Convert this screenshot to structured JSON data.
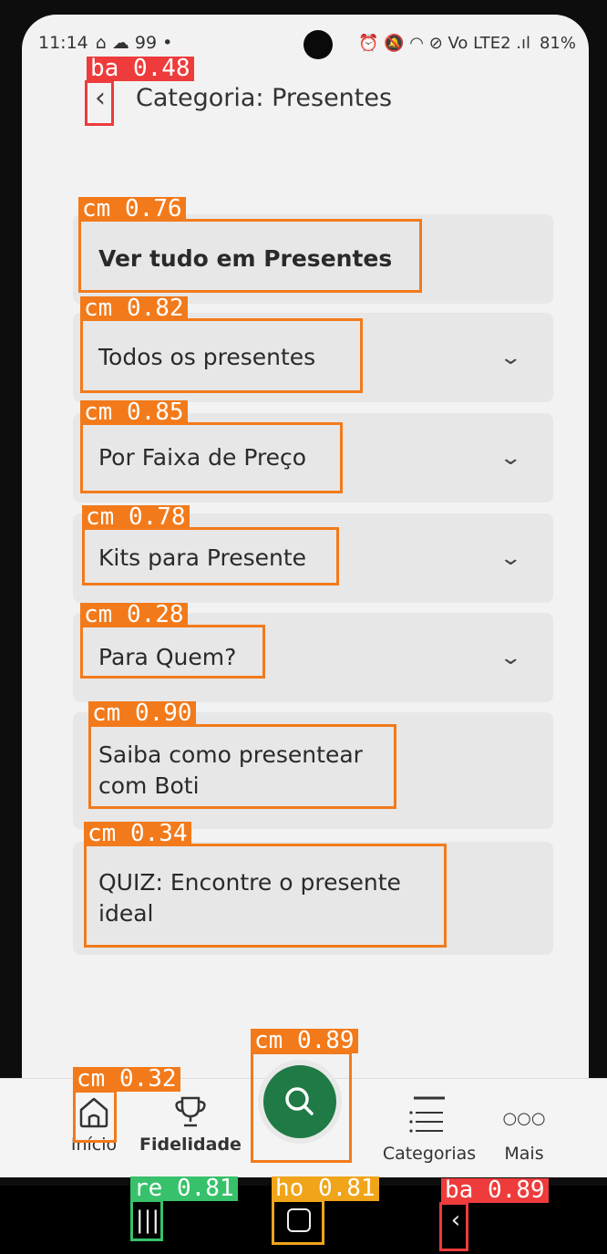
{
  "status_bar": {
    "time": "11:14",
    "left_icons": "⌂ ☁ 99 •",
    "right_icons": "⏰ 🔕 ◠ ⊘ Vo LTE2 .ıl",
    "battery": "81%"
  },
  "header": {
    "title": "Categoria: Presentes"
  },
  "menu": {
    "items": [
      {
        "label": "Ver tudo em Presentes"
      },
      {
        "label": "Todos os presentes"
      },
      {
        "label": "Por Faixa de Preço"
      },
      {
        "label": "Kits para Presente"
      },
      {
        "label": "Para Quem?"
      },
      {
        "label": "Saiba como presentear com Boti"
      },
      {
        "label": "QUIZ: Encontre o presente ideal"
      }
    ]
  },
  "bottom_nav": {
    "inicio": "Início",
    "fidelidade": "Fidelidade",
    "categorias": "Categorias",
    "mais": "Mais"
  },
  "detections": {
    "back_top": "ba 0.48",
    "item0": "cm 0.76",
    "item1": "cm 0.82",
    "item2": "cm 0.85",
    "item3": "cm 0.78",
    "item4": "cm 0.28",
    "item5": "cm 0.90",
    "item6": "cm 0.34",
    "home": "cm 0.32",
    "search": "cm 0.89",
    "recents": "re 0.81",
    "home_sys": "ho 0.81",
    "back_sys": "ba 0.89"
  },
  "colors": {
    "accent": "#1f7a45",
    "detect_orange": "#f27a1b",
    "detect_red": "#ee3b3b"
  }
}
